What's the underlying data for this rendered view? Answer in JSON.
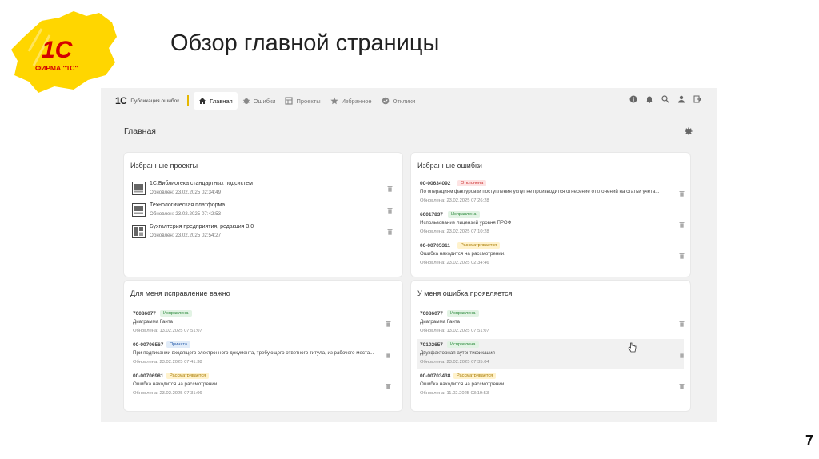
{
  "slide": {
    "title": "Обзор главной страницы",
    "page_number": "7",
    "logo": {
      "mark": "1С",
      "text": "ФИРМА \"1С\"",
      "colors": {
        "splash": "#ffd600",
        "text": "#d40000"
      }
    }
  },
  "app": {
    "brand": {
      "mark": "1С",
      "text": "Публикация ошибок"
    },
    "nav": [
      {
        "label": "Главная",
        "icon": "home-icon",
        "active": true
      },
      {
        "label": "Ошибки",
        "icon": "bug-icon",
        "active": false
      },
      {
        "label": "Проекты",
        "icon": "projects-icon",
        "active": false
      },
      {
        "label": "Избранное",
        "icon": "star-icon",
        "active": false
      },
      {
        "label": "Отклики",
        "icon": "check-circle-icon",
        "active": false
      }
    ],
    "top_icons": [
      "info-icon",
      "bell-icon",
      "search-icon",
      "user-icon",
      "logout-icon"
    ],
    "page_heading": "Главная",
    "favorite_projects": {
      "title": "Избранные проекты",
      "items": [
        {
          "name": "1С:Библиотека стандартных подсистем",
          "updated": "Обновлен: 23.02.2025 02:34:49"
        },
        {
          "name": "Технологическая платформа",
          "updated": "Обновлен: 23.02.2025 07:42:53"
        },
        {
          "name": "Бухгалтерия предприятия, редакция 3.0",
          "updated": "Обновлен: 23.02.2025 02:54:27"
        }
      ]
    },
    "favorite_errors": {
      "title": "Избранные ошибки",
      "items": [
        {
          "id": "00-00634092",
          "status": "Отклонена",
          "status_color": "red",
          "desc": "По операциям фактуровки поступления услуг не производится отнесение отклонений на статьи учета...",
          "updated": "Обновлена: 23.02.2025 07:26:28"
        },
        {
          "id": "60017837",
          "status": "Исправлена",
          "status_color": "green",
          "desc": "Использование лицензий уровня ПРОФ",
          "updated": "Обновлена: 23.02.2025 07:10:28"
        },
        {
          "id": "00-00705311",
          "status": "Рассматривается",
          "status_color": "yellow",
          "desc": "Ошибка находится на рассмотрении.",
          "updated": "Обновлена: 23.02.2025 02:34:46"
        }
      ]
    },
    "important_fix": {
      "title": "Для меня исправление важно",
      "items": [
        {
          "id": "70086077",
          "status": "Исправлена",
          "status_color": "green",
          "desc": "Диаграмма Ганта",
          "updated": "Обновлена: 13.02.2025 07:51:07"
        },
        {
          "id": "00-00706567",
          "status": "Принята",
          "status_color": "blue",
          "desc": "При подписании входящего электронного документа, требующего ответного титула, из рабочего места...",
          "updated": "Обновлена: 23.02.2025 07:41:38"
        },
        {
          "id": "00-00706981",
          "status": "Рассматривается",
          "status_color": "yellow",
          "desc": "Ошибка находится на рассмотрении.",
          "updated": "Обновлена: 23.02.2025 07:31:06"
        }
      ]
    },
    "error_appears": {
      "title": "У меня ошибка проявляется",
      "items": [
        {
          "id": "70086077",
          "status": "Исправлена",
          "status_color": "green",
          "desc": "Диаграмма Ганта",
          "updated": "Обновлена: 13.02.2025 07:51:07"
        },
        {
          "id": "70102657",
          "status": "Исправлена",
          "status_color": "green",
          "desc": "Двухфакторная аутентификация",
          "updated": "Обновлена: 23.02.2025 07:35:04"
        },
        {
          "id": "00-00703438",
          "status": "Рассматривается",
          "status_color": "yellow",
          "desc": "Ошибка находится на рассмотрении.",
          "updated": "Обновлена: 11.02.2025 03:19:53"
        }
      ]
    }
  }
}
